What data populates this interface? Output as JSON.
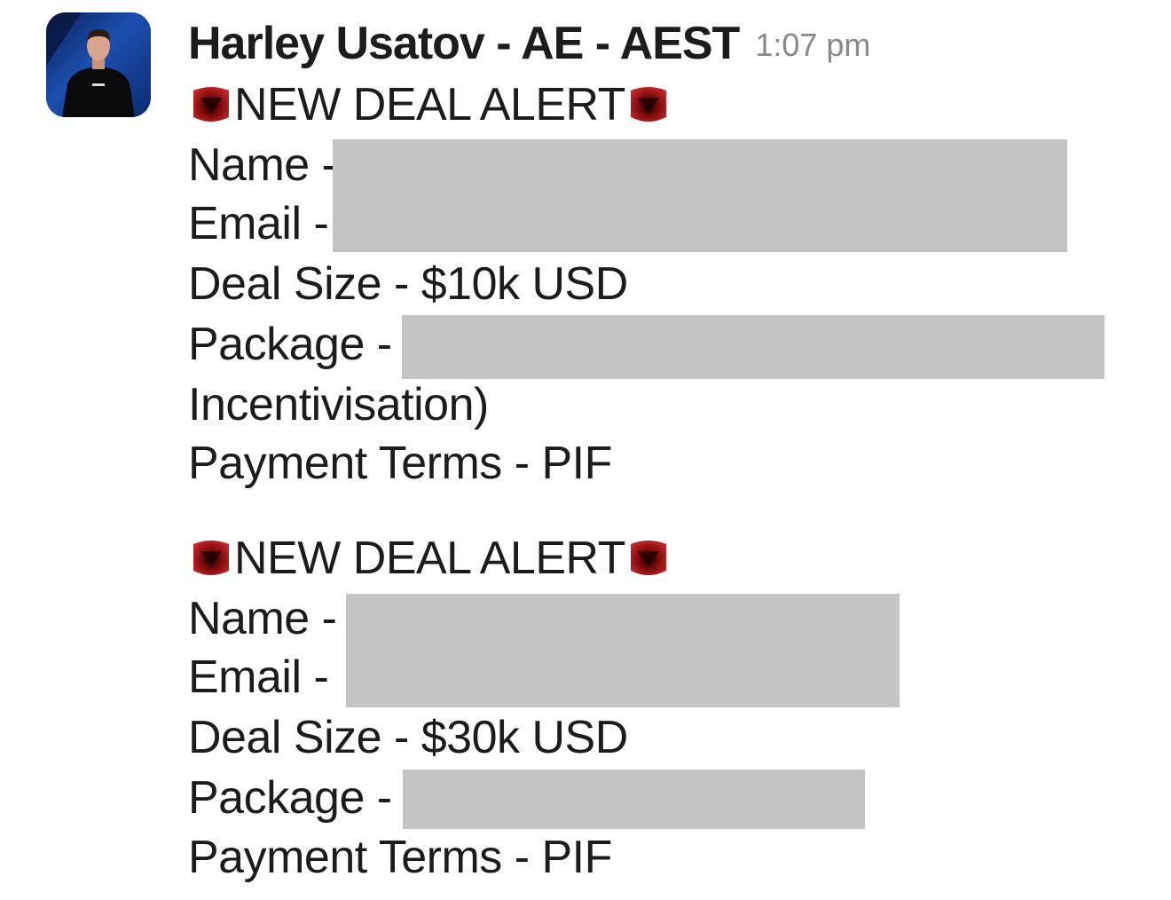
{
  "message": {
    "sender": "Harley Usatov - AE - AEST",
    "timestamp": "1:07 pm",
    "avatar_icon": "user-avatar-photo",
    "emoji_icon": "red-shield-emoji",
    "redaction_color": "#c4c4c4",
    "deals": [
      {
        "heading": "NEW DEAL ALERT",
        "name_label": "Name -",
        "email_label": "Email -",
        "deal_size": "Deal Size - $10k USD",
        "package_label": "Package -",
        "package_cont": "Incentivisation)",
        "payment_terms": "Payment Terms - PIF"
      },
      {
        "heading": "NEW DEAL ALERT",
        "name_label": "Name -",
        "email_label": "Email -",
        "deal_size": "Deal Size - $30k USD",
        "package_label": "Package -",
        "payment_terms": "Payment Terms - PIF"
      }
    ]
  }
}
